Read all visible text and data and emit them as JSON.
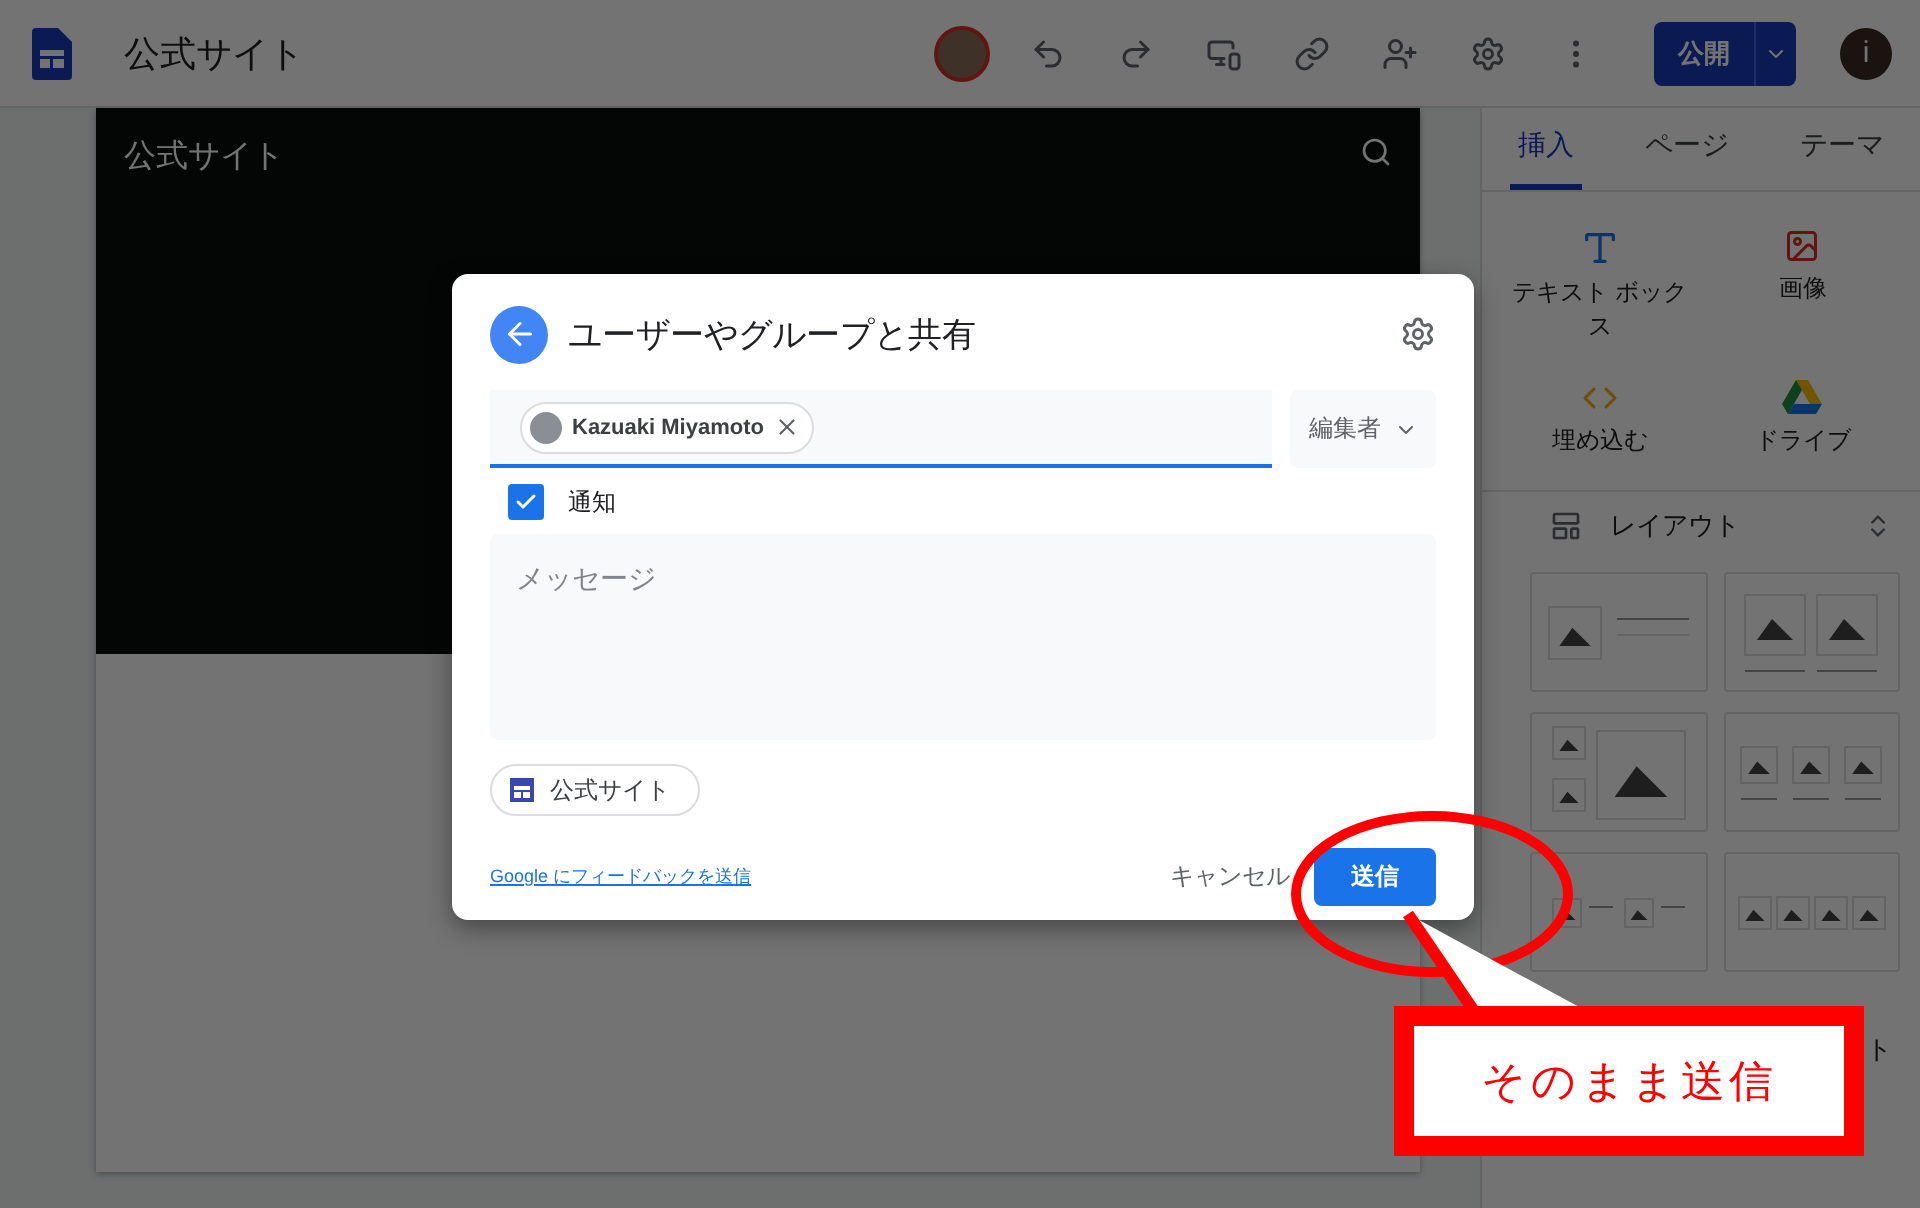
{
  "top_bar": {
    "title": "公式サイト",
    "publish_button": "公開",
    "account_initial": "i"
  },
  "site_page": {
    "header_title": "公式サイト"
  },
  "side_panel": {
    "tabs": [
      {
        "label": "挿入",
        "selected": true
      },
      {
        "label": "ページ",
        "selected": false
      },
      {
        "label": "テーマ",
        "selected": false
      }
    ],
    "insert_items": [
      {
        "label": "テキスト ボックス",
        "kind": "textbox"
      },
      {
        "label": "画像",
        "kind": "image"
      },
      {
        "label": "埋め込む",
        "kind": "embed"
      },
      {
        "label": "ドライブ",
        "kind": "drive"
      }
    ],
    "layout_section": {
      "title": "レイアウト"
    },
    "partial_label": "ト"
  },
  "share_dialog": {
    "title": "ユーザーやグループと共有",
    "recipients": [
      {
        "name": "Kazuaki Miyamoto"
      }
    ],
    "role": "編集者",
    "notify": {
      "label": "通知",
      "checked": true
    },
    "message": {
      "placeholder": "メッセージ"
    },
    "item_chip": "公式サイト",
    "feedback_link": "Google にフィードバックを送信",
    "cancel_button": "キャンセル",
    "send_button": "送信"
  },
  "annotation": {
    "text": "そのまま送信"
  }
}
